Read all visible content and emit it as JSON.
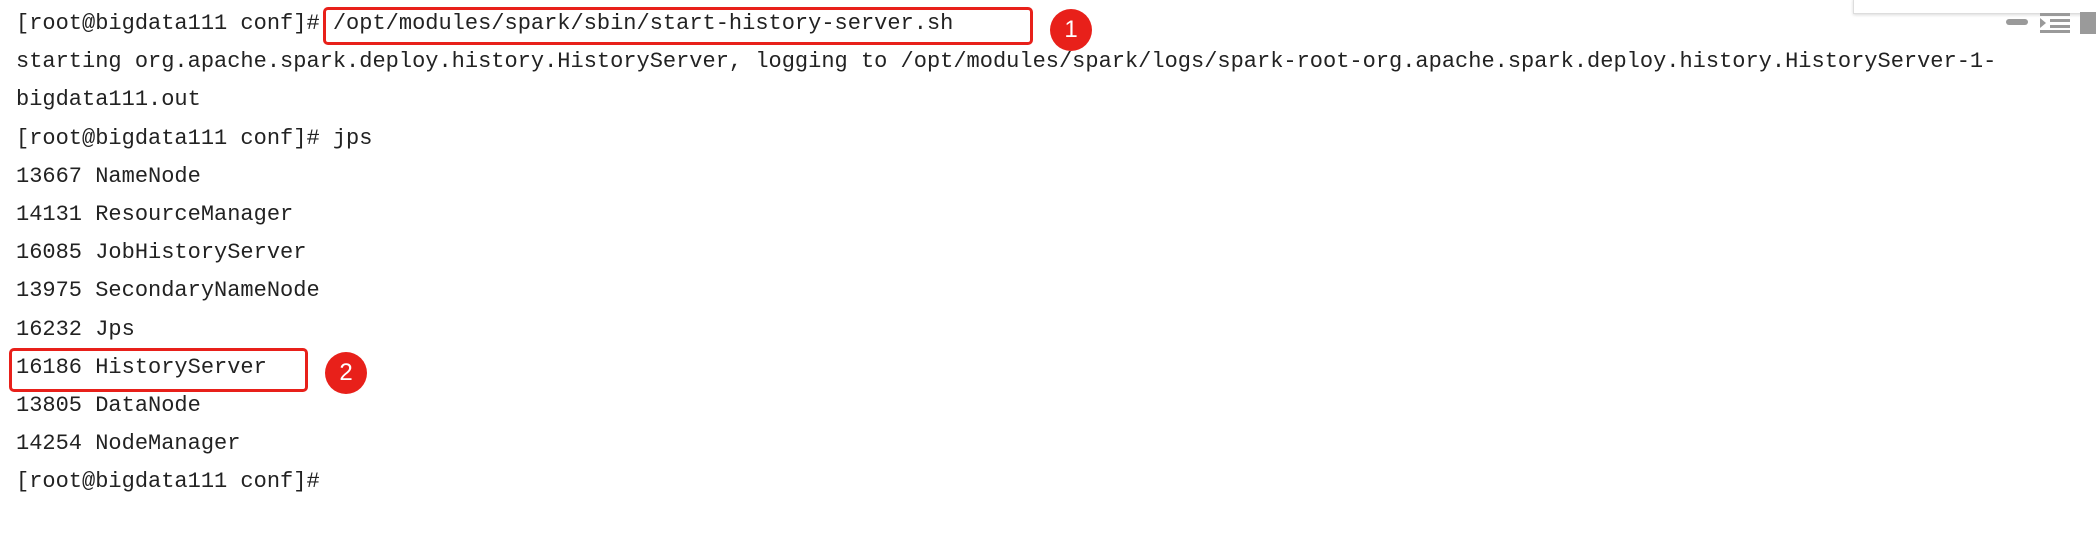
{
  "terminal": {
    "lines": [
      {
        "prompt": "[root@bigdata111 conf]# ",
        "command": "/opt/modules/spark/sbin/start-history-server.sh"
      },
      {
        "text": "starting org.apache.spark.deploy.history.HistoryServer, logging to /opt/modules/spark/logs/spark-root-org.apache.spark.deploy.history.HistoryServer-1-"
      },
      {
        "text": "bigdata111.out"
      },
      {
        "prompt": "[root@bigdata111 conf]# ",
        "command": "jps"
      },
      {
        "text": "13667 NameNode"
      },
      {
        "text": "14131 ResourceManager"
      },
      {
        "text": "16085 JobHistoryServer"
      },
      {
        "text": "13975 SecondaryNameNode"
      },
      {
        "text": "16232 Jps"
      },
      {
        "text": "16186 HistoryServer"
      },
      {
        "text": "13805 DataNode"
      },
      {
        "text": "14254 NodeManager"
      },
      {
        "prompt": "[root@bigdata111 conf]# ",
        "command": ""
      }
    ]
  },
  "annotations": [
    {
      "label": "1",
      "color": "#e8201a"
    },
    {
      "label": "2",
      "color": "#e8201a"
    }
  ],
  "toolbar_icons": [
    "minimize-icon",
    "list-indent-icon",
    "panel-icon"
  ]
}
